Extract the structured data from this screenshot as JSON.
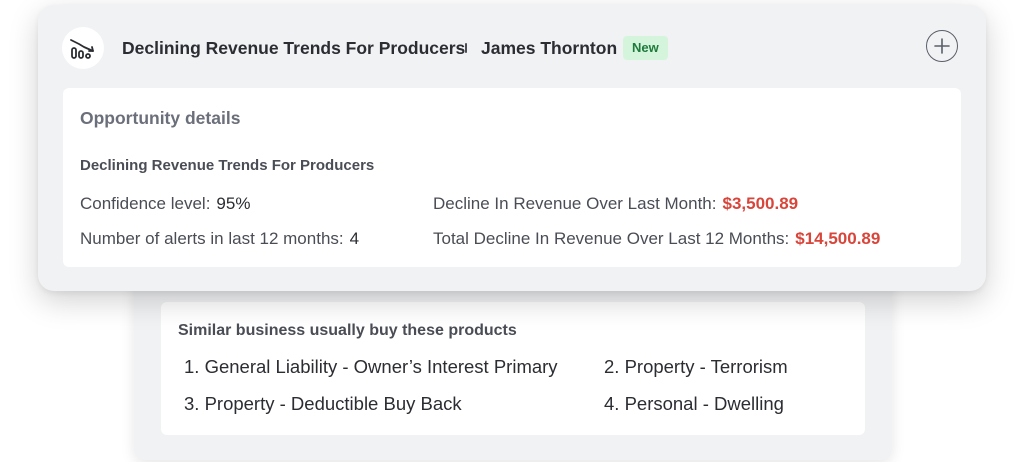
{
  "header": {
    "title": "Declining Revenue Trends For Producers",
    "person": "James Thornton",
    "badge": "New",
    "logo_icon": "declining-bars-icon",
    "add_icon": "plus-circle-icon"
  },
  "details": {
    "heading": "Opportunity details",
    "subtitle": "Declining Revenue Trends For Producers",
    "confidence_label": "Confidence level:",
    "confidence_value": "95%",
    "alerts_label": "Number of alerts in last 12 months:",
    "alerts_value": "4",
    "decline_month_label": "Decline In Revenue Over Last Month:",
    "decline_month_value": "$3,500.89",
    "decline_year_label": "Total Decline In Revenue Over Last 12 Months:",
    "decline_year_value": "$14,500.89"
  },
  "similar": {
    "title": "Similar business usually buy these products",
    "products": [
      "1. General Liability - Owner’s Interest Primary",
      "2. Property - Terrorism",
      "3. Property - Deductible Buy Back",
      "4. Personal - Dwelling"
    ]
  },
  "colors": {
    "accent_red": "#d8453a",
    "badge_bg": "#d4f5dc",
    "badge_text": "#1f7a3c"
  }
}
